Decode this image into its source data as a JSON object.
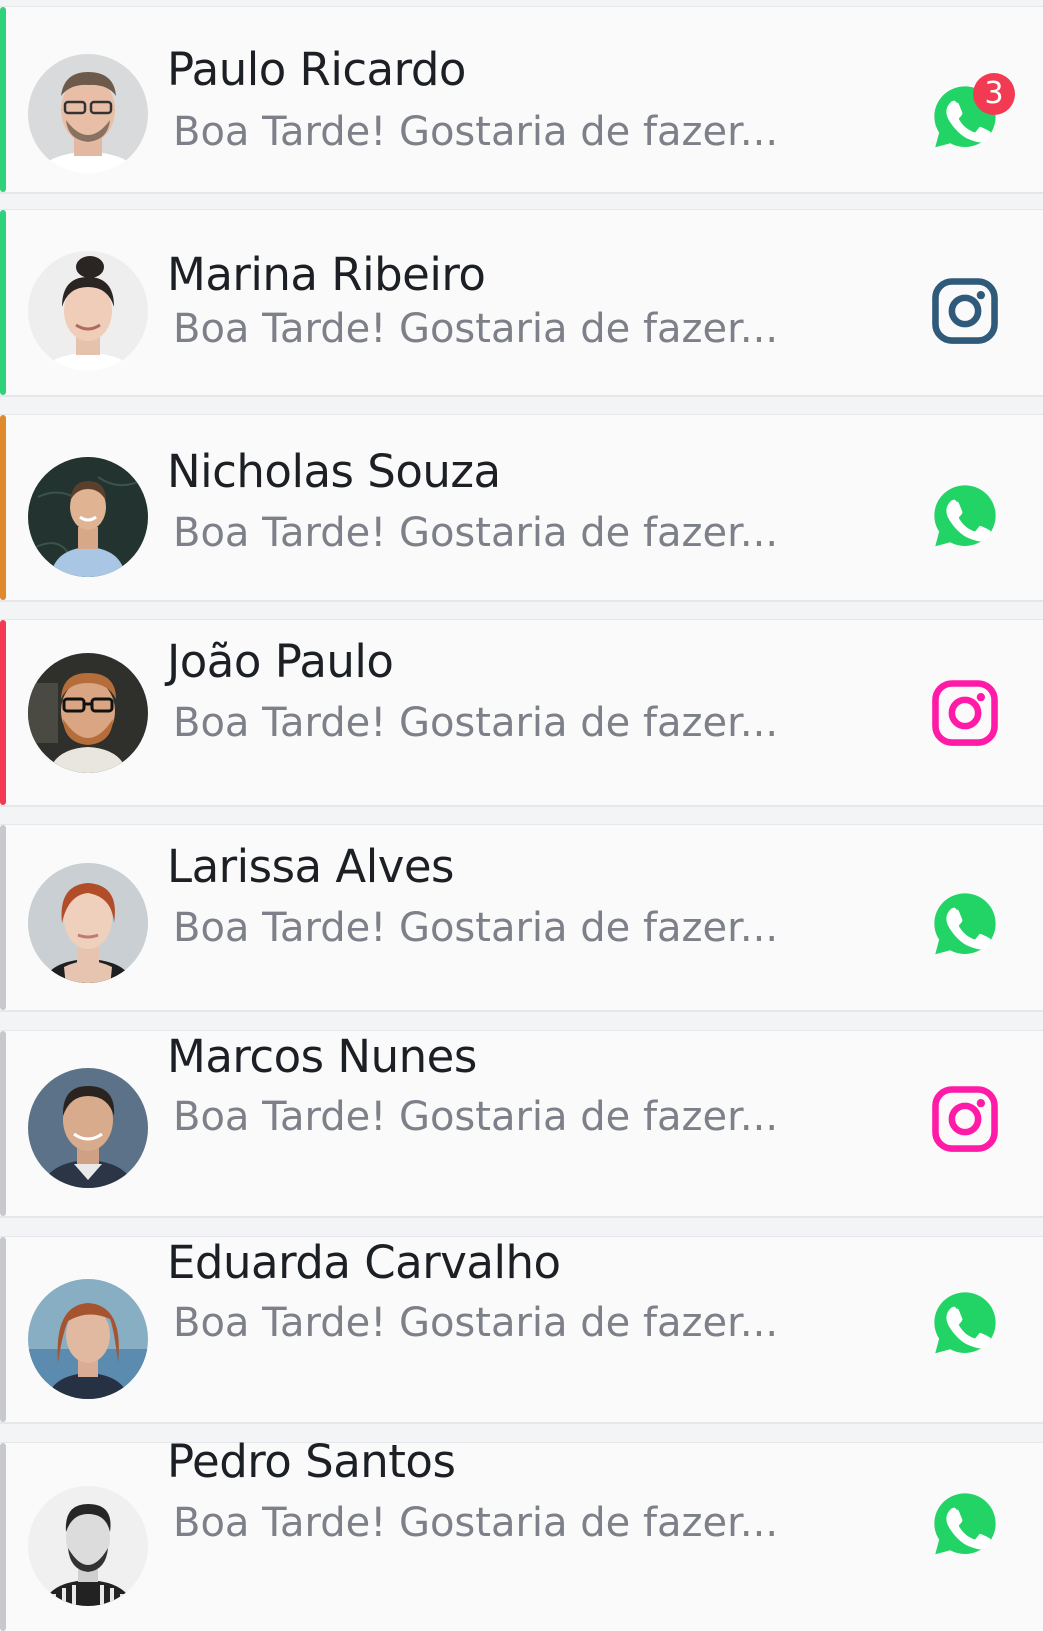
{
  "colors": {
    "accent_green": "#2fd27a",
    "accent_orange": "#e08a2c",
    "accent_red": "#f23b53",
    "accent_gray": "#c7c9cd",
    "whatsapp": "#22d366",
    "instagram_gray": "#2f5a7a",
    "instagram_pink": "#ff1aa8",
    "badge": "#f23b53"
  },
  "conversations": [
    {
      "name": "Paulo Ricardo",
      "preview": "Boa Tarde! Gostaria de fazer...",
      "channel_icon": "whatsapp-icon",
      "unread": "3"
    },
    {
      "name": "Marina Ribeiro",
      "preview": "Boa Tarde! Gostaria de fazer...",
      "channel_icon": "instagram-icon"
    },
    {
      "name": "Nicholas Souza",
      "preview": "Boa Tarde! Gostaria de fazer...",
      "channel_icon": "whatsapp-icon"
    },
    {
      "name": "João Paulo",
      "preview": "Boa Tarde! Gostaria de fazer...",
      "channel_icon": "instagram-icon"
    },
    {
      "name": "Larissa Alves",
      "preview": "Boa Tarde! Gostaria de fazer...",
      "channel_icon": "whatsapp-icon"
    },
    {
      "name": "Marcos Nunes",
      "preview": "Boa Tarde! Gostaria de fazer...",
      "channel_icon": "instagram-icon"
    },
    {
      "name": "Eduarda Carvalho",
      "preview": "Boa Tarde! Gostaria de fazer...",
      "channel_icon": "whatsapp-icon"
    },
    {
      "name": "Pedro Santos",
      "preview": "Boa Tarde! Gostaria de fazer...",
      "channel_icon": "whatsapp-icon"
    }
  ]
}
